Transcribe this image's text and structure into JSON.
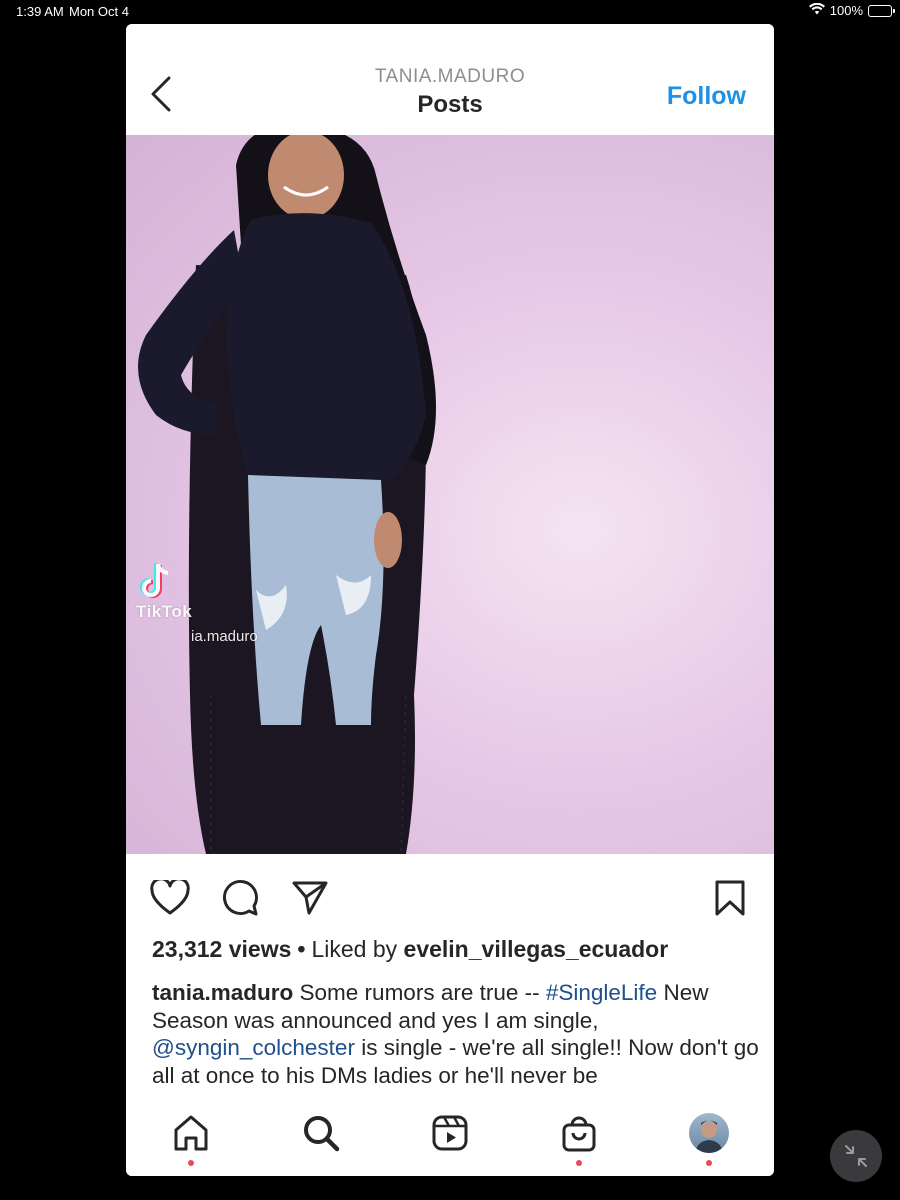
{
  "status_bar": {
    "time": "1:39 AM",
    "date": "Mon Oct 4",
    "battery": "100%"
  },
  "header": {
    "username": "TANIA.MADURO",
    "title": "Posts",
    "follow_label": "Follow",
    "follow_color": "#1e90e6"
  },
  "post": {
    "watermark_brand": "TikTok",
    "watermark_handle": "ia.maduro",
    "views": "23,312 views",
    "separator": "•",
    "liked_by_prefix": "Liked by",
    "liked_by_user": "evelin_villegas_ecuador",
    "caption_user": "tania.maduro",
    "caption_part1": " Some rumors are true -- ",
    "caption_hashtag": "#SingleLife",
    "caption_part2": " New Season was announced and yes I am single, ",
    "caption_mention": "@syngin_colchester",
    "caption_part3": " is single - we're all single!! Now don't go all at once to his DMs ladies or he'll never be"
  },
  "actions": [
    "heart-icon",
    "comment-icon",
    "share-icon",
    "bookmark-icon"
  ],
  "tab_bar": {
    "items": [
      "home",
      "search",
      "reels",
      "shop",
      "profile"
    ]
  },
  "colors": {
    "link_blue": "#1f4f8c",
    "notification_red": "#ed4956"
  }
}
